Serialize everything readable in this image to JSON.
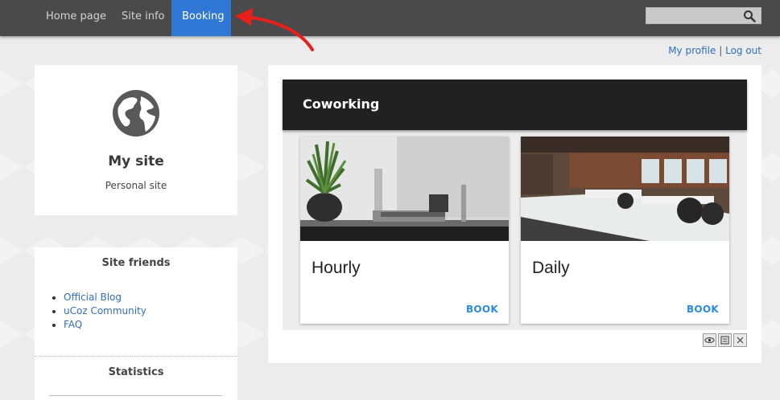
{
  "nav": {
    "items": [
      {
        "label": "Home page"
      },
      {
        "label": "Site info"
      },
      {
        "label": "Booking"
      }
    ],
    "search": {
      "placeholder": ""
    }
  },
  "profile": {
    "my_profile": "My profile",
    "separator": "|",
    "log_out": "Log out"
  },
  "site": {
    "title": "My site",
    "subtitle": "Personal site"
  },
  "friends": {
    "heading": "Site friends",
    "links": [
      {
        "label": "Official Blog"
      },
      {
        "label": "uCoz Community"
      },
      {
        "label": "FAQ"
      }
    ]
  },
  "stats": {
    "heading": "Statistics"
  },
  "coworking": {
    "title": "Coworking",
    "cards": [
      {
        "name": "Hourly",
        "action": "BOOK"
      },
      {
        "name": "Daily",
        "action": "BOOK"
      }
    ]
  },
  "colors": {
    "nav_bg": "#4a4a4a",
    "nav_active": "#2f78d6",
    "header_bg": "#212121",
    "link": "#2f6fb8",
    "book": "#2b8ce0",
    "arrow": "#e8201c"
  },
  "icons": [
    "search-icon",
    "globe-icon",
    "eye-icon",
    "edit-icon",
    "close-icon"
  ]
}
